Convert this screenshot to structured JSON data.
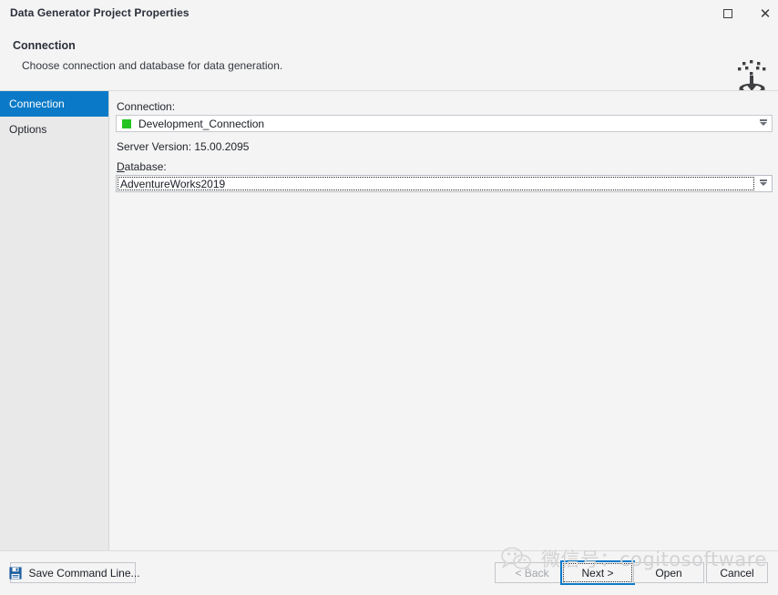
{
  "window": {
    "title": "Data Generator Project Properties",
    "maximize_icon": "maximize-icon",
    "close_icon": "close-icon"
  },
  "header": {
    "title": "Connection",
    "subtitle": "Choose connection and database for data generation.",
    "brand_icon": "data-generator-database-icon"
  },
  "sidebar": {
    "items": [
      {
        "label": "Connection",
        "selected": true
      },
      {
        "label": "Options",
        "selected": false
      }
    ]
  },
  "main": {
    "connection_label": "Connection:",
    "connection_value": "Development_Connection",
    "connection_status_color": "#22c322",
    "server_version": "Server Version: 15.00.2095",
    "database_label_prefix": "D",
    "database_label_rest": "atabase:",
    "database_value": "AdventureWorks2019",
    "dropdown_icon": "chevron-down-icon"
  },
  "footer": {
    "save_command_line": "Save Command Line...",
    "save_icon": "floppy-disk-save-icon",
    "back": "< Back",
    "next": "Next >",
    "open": "Open",
    "cancel": "Cancel"
  },
  "watermark": {
    "text": "微信号：cogitosoftware",
    "logo": "wechat-logo-icon"
  },
  "colors": {
    "accent": "#0a7ac8",
    "window_bg": "#f4f4f4",
    "sidebar_bg": "#e9e9e9",
    "status_green": "#22c322",
    "save_icon_blue": "#1c5d9e"
  }
}
